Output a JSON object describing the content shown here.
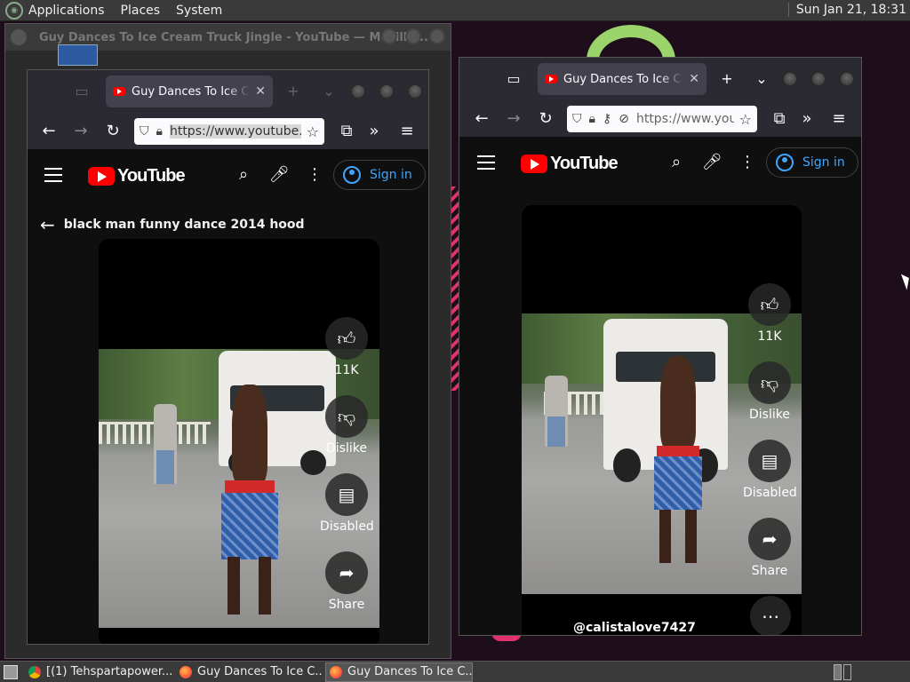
{
  "top_panel": {
    "menus": [
      "Applications",
      "Places",
      "System"
    ],
    "clock": "Sun Jan 21, 18:31"
  },
  "background_window": {
    "title": "Guy Dances To Ice Cream Truck Jingle - YouTube — Mozilla..."
  },
  "left_browser": {
    "tab_title": "Guy Dances To Ice Cream Truck Jingle - YouTube",
    "url": "https://www.youtube.com",
    "yt": {
      "logo": "YouTube",
      "sign_in": "Sign in",
      "search_query": "black man funny dance 2014 hood",
      "likes": "11K",
      "dislike": "Dislike",
      "comments": "Disabled",
      "share": "Share"
    }
  },
  "right_browser": {
    "tab_title": "Guy Dances To Ice Cream Truck Jingle - YouTube",
    "url": "https://www.youtube.com",
    "yt": {
      "logo": "YouTube",
      "sign_in": "Sign in",
      "likes": "11K",
      "dislike": "Dislike",
      "comments": "Disabled",
      "share": "Share",
      "channel": "@calistalove7427"
    }
  },
  "taskbar": {
    "tasks": [
      {
        "label": "[(1) Tehspartapower...",
        "icon": "chrome-icon"
      },
      {
        "label": "Guy Dances To Ice C...",
        "icon": "firefox-icon"
      },
      {
        "label": "Guy Dances To Ice C...",
        "icon": "firefox-icon"
      }
    ]
  }
}
